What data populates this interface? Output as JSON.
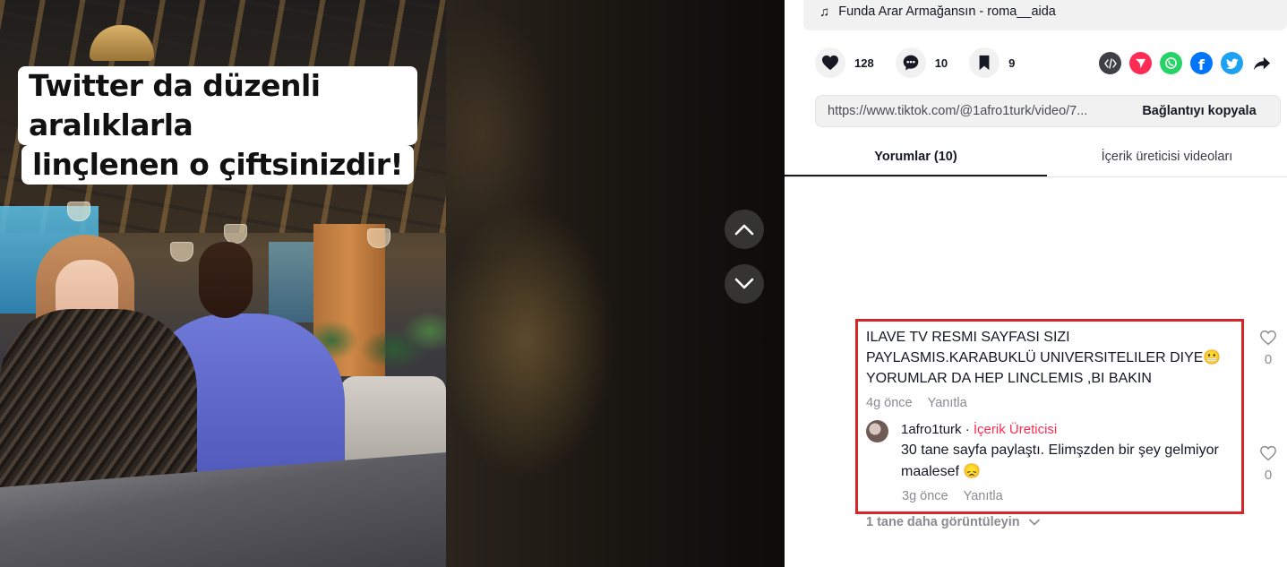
{
  "video": {
    "caption_line1": "Twitter da düzenli aralıklarla",
    "caption_line2": "linçlenen o çiftsinizdir!"
  },
  "music": {
    "icon": "music-note-icon",
    "label": "Funda Arar Armağansın - roma__aida"
  },
  "actions": {
    "likes": "128",
    "comments": "10",
    "saves": "9"
  },
  "share": {
    "icons": [
      "embed-icon",
      "send-icon",
      "whatsapp-icon",
      "facebook-icon",
      "twitter-icon",
      "share-arrow-icon"
    ],
    "colors": {
      "embed": "#3f3f46",
      "send": "#fe2c55",
      "whatsapp": "#25d366",
      "facebook": "#0075fa",
      "twitter": "#1da1f2"
    }
  },
  "link": {
    "url": "https://www.tiktok.com/@1afro1turk/video/7...",
    "copy_label": "Bağlantıyı kopyala"
  },
  "tabs": {
    "comments": "Yorumlar (10)",
    "creator_videos": "İçerik üreticisi videoları"
  },
  "comment": {
    "text": "ILAVE TV RESMI SAYFASI SIZI PAYLASMIS.KARABUKLÜ UNIVERSITELILER DIYE😬 YORUMLAR DA HEP LINCLEMIS ,BI BAKIN",
    "time": "4g önce",
    "reply_label": "Yanıtla",
    "likes": "0"
  },
  "reply": {
    "username": "1afro1turk",
    "separator": " · ",
    "badge": "İçerik Üreticisi",
    "text": "30 tane sayfa paylaştı. Elimşzden bir şey gelmiyor maalesef 😞",
    "time": "3g önce",
    "reply_label": "Yanıtla",
    "likes": "0"
  },
  "more_replies": "1 tane daha görüntüleyin",
  "accent_colors": {
    "highlight_border": "#d7262a",
    "creator_badge": "#fe2c55"
  }
}
